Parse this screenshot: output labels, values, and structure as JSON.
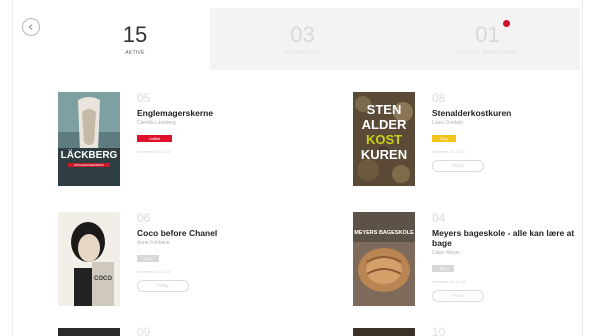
{
  "tabs": [
    {
      "count": "15",
      "label": "Aktive",
      "active": true
    },
    {
      "count": "03",
      "label": "Reserveret",
      "active": false
    },
    {
      "count": "01",
      "label": "Klar til afhentning",
      "active": false,
      "notification": true
    }
  ],
  "books": [
    {
      "num": "05",
      "title": "Englemagerskerne",
      "author": "Camilla Läckberg",
      "badge": "Udlånt",
      "badge_color": "red",
      "meta": "Afleveres 03.11.14",
      "button": ""
    },
    {
      "num": "08",
      "title": "Stenalderkostkuren",
      "author": "Louis Cordain",
      "badge": "Bog",
      "badge_color": "yellow",
      "meta": "Afleveres 01.11.14",
      "button": "Forny"
    },
    {
      "num": "06",
      "title": "Coco before Chanel",
      "author": "Anne Fontaine",
      "badge": "DVD",
      "badge_color": "grey",
      "meta": "Afleveres 01.11.14",
      "button": "Forny"
    },
    {
      "num": "04",
      "title": "Meyers bageskole - alle kan lære at bage",
      "author": "Claus Meyer",
      "badge": "Bog",
      "badge_color": "grey",
      "meta": "Afleveres 01.11.14",
      "button": "Forny"
    }
  ],
  "covers": {
    "lackberg": {
      "author_text": "LÄCKBERG",
      "subtitle": "ENGLEMAGERSKEN",
      "accent": "#c81a2a"
    },
    "stenalder": {
      "lines": [
        "STEN",
        "ALDER",
        "KOST",
        "KUREN"
      ],
      "accent": "#c6d11c"
    },
    "coco": {
      "text": "COCO"
    },
    "meyers": {
      "text": "MEYERS BAGESKOLE"
    }
  },
  "partial_row": {
    "num_left": "09",
    "num_right": "10"
  },
  "colors": {
    "accent_red": "#d0112b",
    "badge_yellow": "#f3c41b",
    "tab_bg": "#f3f3f3"
  },
  "icons": {
    "back": "back-arrow-icon"
  }
}
